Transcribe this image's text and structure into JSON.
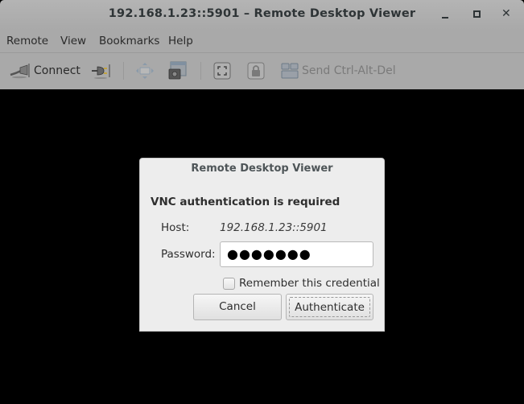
{
  "window": {
    "title": "192.168.1.23::5901 – Remote Desktop Viewer",
    "controls": {
      "minimize": "minimize",
      "maximize": "maximize",
      "close": "✕"
    }
  },
  "menubar": {
    "items": [
      "Remote",
      "View",
      "Bookmarks",
      "Help"
    ]
  },
  "toolbar": {
    "connect_label": "Connect",
    "send_cad_label": "Send Ctrl-Alt-Del",
    "icons": [
      "connect-plug-icon",
      "disconnect-plug-icon",
      "scroll-icon",
      "screenshot-icon",
      "fullscreen-icon",
      "keyboard-lock-icon",
      "send-keys-icon"
    ]
  },
  "dialog": {
    "title": "Remote Desktop Viewer",
    "heading": "VNC authentication is required",
    "host_label": "Host:",
    "host_value": "192.168.1.23::5901",
    "password_label": "Password:",
    "password_value": "●●●●●●●",
    "remember_label": "Remember this credential",
    "remember_checked": false,
    "cancel_label": "Cancel",
    "authenticate_label": "Authenticate"
  }
}
